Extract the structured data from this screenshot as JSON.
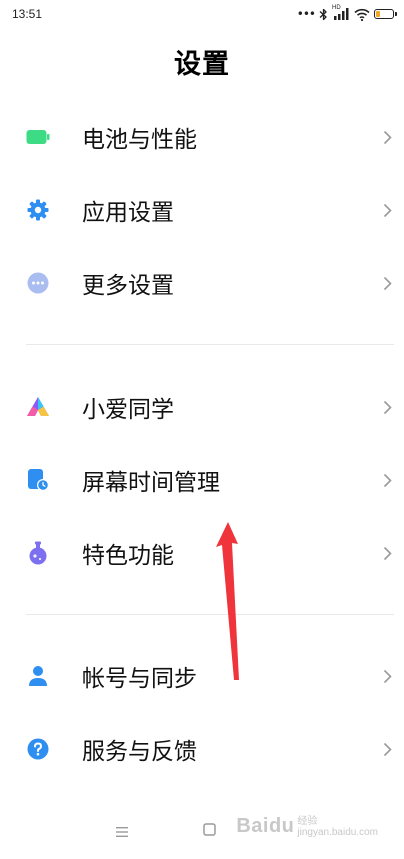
{
  "status_bar": {
    "time": "13:51",
    "icons": [
      "dots-icon",
      "bluetooth-icon",
      "signal-hd-icon",
      "wifi-icon",
      "battery-icon"
    ],
    "network_tag": "HD"
  },
  "page": {
    "title": "设置"
  },
  "sections": [
    {
      "items": [
        {
          "label": "电池与性能",
          "icon": "battery-icon",
          "color": "#3ddc84"
        },
        {
          "label": "应用设置",
          "icon": "gear-icon",
          "color": "#2f8ff1"
        },
        {
          "label": "更多设置",
          "icon": "more-icon",
          "color": "#9fb3e8"
        }
      ]
    },
    {
      "items": [
        {
          "label": "小爱同学",
          "icon": "xiaoai-icon",
          "color": "#8a5cf6"
        },
        {
          "label": "屏幕时间管理",
          "icon": "screen-time-icon",
          "color": "#2f8ff1"
        },
        {
          "label": "特色功能",
          "icon": "potion-icon",
          "color": "#7c6ff0"
        }
      ]
    },
    {
      "items": [
        {
          "label": "帐号与同步",
          "icon": "account-icon",
          "color": "#2f8ff1"
        },
        {
          "label": "服务与反馈",
          "icon": "help-icon",
          "color": "#2f8ff1"
        }
      ]
    }
  ],
  "nav_bar": {
    "buttons": [
      "menu-icon",
      "home-icon"
    ]
  },
  "watermark": {
    "brand": "Baidu",
    "sub_line1": "经验",
    "sub_line2": "jingyan.baidu.com"
  },
  "annotation": {
    "type": "red-arrow",
    "color": "#f0343c",
    "points_to": "屏幕时间管理"
  }
}
